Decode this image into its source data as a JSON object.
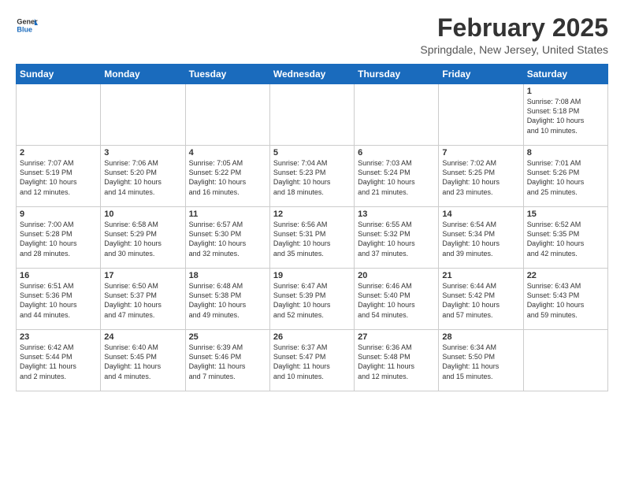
{
  "header": {
    "logo_general": "General",
    "logo_blue": "Blue",
    "month_title": "February 2025",
    "location": "Springdale, New Jersey, United States"
  },
  "days_of_week": [
    "Sunday",
    "Monday",
    "Tuesday",
    "Wednesday",
    "Thursday",
    "Friday",
    "Saturday"
  ],
  "weeks": [
    [
      {
        "day": "",
        "text": ""
      },
      {
        "day": "",
        "text": ""
      },
      {
        "day": "",
        "text": ""
      },
      {
        "day": "",
        "text": ""
      },
      {
        "day": "",
        "text": ""
      },
      {
        "day": "",
        "text": ""
      },
      {
        "day": "1",
        "text": "Sunrise: 7:08 AM\nSunset: 5:18 PM\nDaylight: 10 hours\nand 10 minutes."
      }
    ],
    [
      {
        "day": "2",
        "text": "Sunrise: 7:07 AM\nSunset: 5:19 PM\nDaylight: 10 hours\nand 12 minutes."
      },
      {
        "day": "3",
        "text": "Sunrise: 7:06 AM\nSunset: 5:20 PM\nDaylight: 10 hours\nand 14 minutes."
      },
      {
        "day": "4",
        "text": "Sunrise: 7:05 AM\nSunset: 5:22 PM\nDaylight: 10 hours\nand 16 minutes."
      },
      {
        "day": "5",
        "text": "Sunrise: 7:04 AM\nSunset: 5:23 PM\nDaylight: 10 hours\nand 18 minutes."
      },
      {
        "day": "6",
        "text": "Sunrise: 7:03 AM\nSunset: 5:24 PM\nDaylight: 10 hours\nand 21 minutes."
      },
      {
        "day": "7",
        "text": "Sunrise: 7:02 AM\nSunset: 5:25 PM\nDaylight: 10 hours\nand 23 minutes."
      },
      {
        "day": "8",
        "text": "Sunrise: 7:01 AM\nSunset: 5:26 PM\nDaylight: 10 hours\nand 25 minutes."
      }
    ],
    [
      {
        "day": "9",
        "text": "Sunrise: 7:00 AM\nSunset: 5:28 PM\nDaylight: 10 hours\nand 28 minutes."
      },
      {
        "day": "10",
        "text": "Sunrise: 6:58 AM\nSunset: 5:29 PM\nDaylight: 10 hours\nand 30 minutes."
      },
      {
        "day": "11",
        "text": "Sunrise: 6:57 AM\nSunset: 5:30 PM\nDaylight: 10 hours\nand 32 minutes."
      },
      {
        "day": "12",
        "text": "Sunrise: 6:56 AM\nSunset: 5:31 PM\nDaylight: 10 hours\nand 35 minutes."
      },
      {
        "day": "13",
        "text": "Sunrise: 6:55 AM\nSunset: 5:32 PM\nDaylight: 10 hours\nand 37 minutes."
      },
      {
        "day": "14",
        "text": "Sunrise: 6:54 AM\nSunset: 5:34 PM\nDaylight: 10 hours\nand 39 minutes."
      },
      {
        "day": "15",
        "text": "Sunrise: 6:52 AM\nSunset: 5:35 PM\nDaylight: 10 hours\nand 42 minutes."
      }
    ],
    [
      {
        "day": "16",
        "text": "Sunrise: 6:51 AM\nSunset: 5:36 PM\nDaylight: 10 hours\nand 44 minutes."
      },
      {
        "day": "17",
        "text": "Sunrise: 6:50 AM\nSunset: 5:37 PM\nDaylight: 10 hours\nand 47 minutes."
      },
      {
        "day": "18",
        "text": "Sunrise: 6:48 AM\nSunset: 5:38 PM\nDaylight: 10 hours\nand 49 minutes."
      },
      {
        "day": "19",
        "text": "Sunrise: 6:47 AM\nSunset: 5:39 PM\nDaylight: 10 hours\nand 52 minutes."
      },
      {
        "day": "20",
        "text": "Sunrise: 6:46 AM\nSunset: 5:40 PM\nDaylight: 10 hours\nand 54 minutes."
      },
      {
        "day": "21",
        "text": "Sunrise: 6:44 AM\nSunset: 5:42 PM\nDaylight: 10 hours\nand 57 minutes."
      },
      {
        "day": "22",
        "text": "Sunrise: 6:43 AM\nSunset: 5:43 PM\nDaylight: 10 hours\nand 59 minutes."
      }
    ],
    [
      {
        "day": "23",
        "text": "Sunrise: 6:42 AM\nSunset: 5:44 PM\nDaylight: 11 hours\nand 2 minutes."
      },
      {
        "day": "24",
        "text": "Sunrise: 6:40 AM\nSunset: 5:45 PM\nDaylight: 11 hours\nand 4 minutes."
      },
      {
        "day": "25",
        "text": "Sunrise: 6:39 AM\nSunset: 5:46 PM\nDaylight: 11 hours\nand 7 minutes."
      },
      {
        "day": "26",
        "text": "Sunrise: 6:37 AM\nSunset: 5:47 PM\nDaylight: 11 hours\nand 10 minutes."
      },
      {
        "day": "27",
        "text": "Sunrise: 6:36 AM\nSunset: 5:48 PM\nDaylight: 11 hours\nand 12 minutes."
      },
      {
        "day": "28",
        "text": "Sunrise: 6:34 AM\nSunset: 5:50 PM\nDaylight: 11 hours\nand 15 minutes."
      },
      {
        "day": "",
        "text": ""
      }
    ]
  ]
}
